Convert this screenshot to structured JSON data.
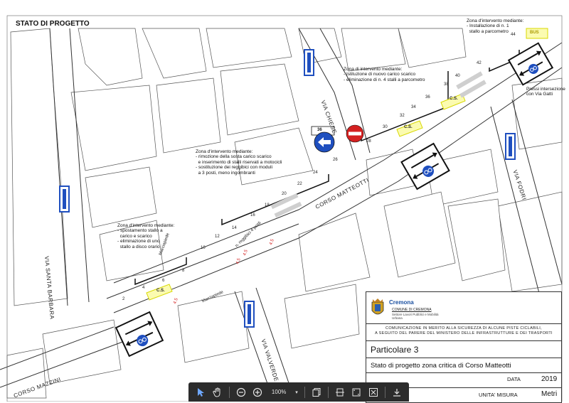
{
  "drawing": {
    "title": "STATO DI PROGETTO"
  },
  "notes": {
    "zona1": "Zona d'intervento mediante:\n- spostamento stallo a\n  carico e scarico\n- eliminazione di uno\n  stallo a disco orario",
    "zona2": "Zona d'intervento mediante:\n- rimozione della sosta carico scarico\n  e inserimento di stalli riservati a motocicli\n- sostituzione dei reggibici con moduli\n  a 3 posti, meno ingombranti",
    "zona3": "Zona di intervento mediante:\n- Istituzione di nuovo carico scarico\n- eliminazione di n. 4 stalli a parcometro",
    "zona4": "Zona d'intervento mediante:\n- Installazione di n. 1\n  stallo a parcometro",
    "incrocio": "Pressi intersezione\ncon Via Gatti"
  },
  "streets": {
    "santa_barbara": "VIA SANTA BARBARA",
    "chiese": "VIA CHIESE",
    "corso_matteotti": "CORSO MATTEOTTI",
    "fodri": "VIA FODRI",
    "valverde": "VIA VALVERDE",
    "corso_mazzini": "CORSO MAZZINI",
    "marciapiede": "Marciapiede"
  },
  "numbers": [
    "2",
    "4",
    "6",
    "8",
    "10",
    "12",
    "14",
    "16",
    "18",
    "20",
    "22",
    "24",
    "26",
    "28",
    "30",
    "32",
    "34",
    "36",
    "38",
    "40",
    "42",
    "44"
  ],
  "markings": {
    "cs": "C.S.",
    "bus": "BUS",
    "reggibici": "n. reggibici 4 posti",
    "sign_36": "36"
  },
  "titleblock": {
    "city": "Cremona",
    "comune": "COMUNE DI CREMONA",
    "settore": "Settore Lavori Pubblici e Mobilità Urbana",
    "description": "COMUNICAZIONE IN MERITO ALLA SICUREZZA DI ALCUNE PISTE CICLABILI,\nA SEGUITO DEL PARERE DEL MINISTERO DELLE INFRASTRUTTURE E DEI TRASPORTI",
    "particolare": "Particolare 3",
    "stato": "Stato di progetto zona critica di Corso Matteotti",
    "data_label": "DATA",
    "data_value": "2019",
    "unita_label": "UNITA' MISURA",
    "unita_value": "Metri"
  },
  "toolbar": {
    "zoom": "100%"
  },
  "colors": {
    "sign_blue": "#1f4fbf",
    "no_entry_red": "#d42020",
    "cs_yellow": "#e8e840",
    "street_line": "#333333"
  }
}
